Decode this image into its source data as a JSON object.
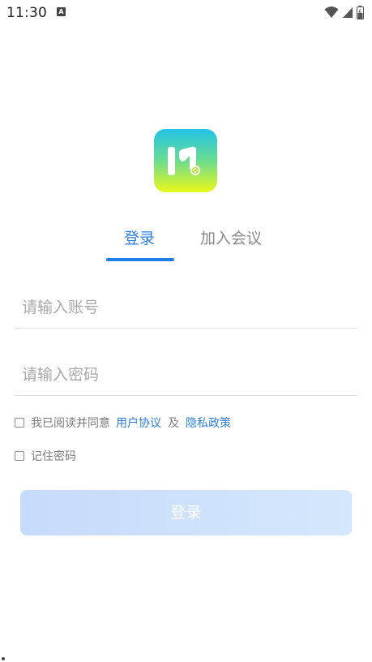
{
  "status_bar": {
    "time": "11:30",
    "notification_icon": "a-icon",
    "wifi_icon": "wifi-icon",
    "signal_icon": "signal-icon",
    "battery_icon": "battery-icon"
  },
  "logo": {
    "icon": "app-logo",
    "gradient_colors": [
      "#23c3e9",
      "#6bdc8f",
      "#ecf81a"
    ]
  },
  "tabs": [
    {
      "label": "登录",
      "active": true
    },
    {
      "label": "加入会议",
      "active": false
    }
  ],
  "form": {
    "account_placeholder": "请输入账号",
    "password_placeholder": "请输入密码",
    "agree_text": "我已阅读并同意",
    "user_agreement": "用户协议",
    "and_text": "及",
    "privacy_policy": "隐私政策",
    "remember_password": "记住密码",
    "login_button": "登录"
  },
  "colors": {
    "accent": "#2d7ed8",
    "tab_indicator": "#1f7ee8",
    "button_bg": "#c6dbfb"
  }
}
